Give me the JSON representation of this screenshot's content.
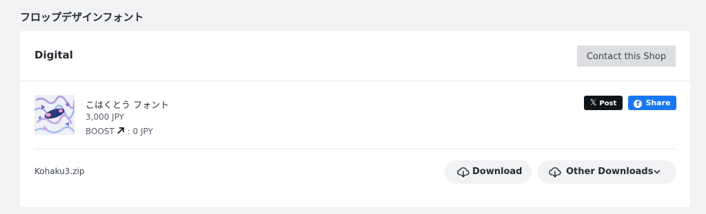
{
  "page": {
    "heading": "フロップデザインフォント"
  },
  "card": {
    "category_title": "Digital",
    "contact_button_label": "Contact this Shop"
  },
  "item": {
    "name": "こはくとう フォント",
    "price": "3,000 JPY",
    "boost_label": "BOOST",
    "boost_value": ": 0 JPY",
    "thumbnail_icon": "product-thumbnail"
  },
  "share": {
    "x_post_label": "Post",
    "fb_share_label": "Share",
    "x_color": "#0f1419",
    "fb_color": "#1877f2"
  },
  "file": {
    "name": "Kohaku3.zip",
    "download_label": "Download",
    "other_downloads_label": "Other Downloads",
    "download_icon": "cloud-download-icon",
    "dropdown_icon": "chevron-down-icon"
  }
}
